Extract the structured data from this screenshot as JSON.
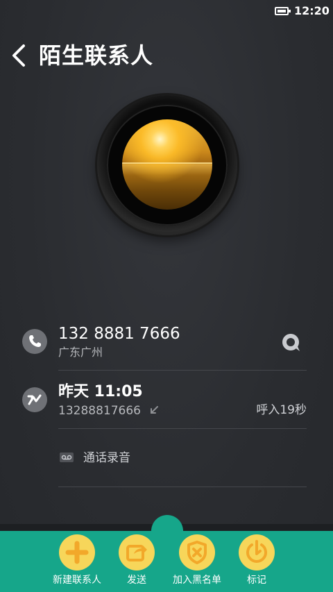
{
  "status_bar": {
    "time": "12:20",
    "battery_icon": "battery-icon"
  },
  "header": {
    "title": "陌生联系人",
    "back_icon": "chevron-left-icon"
  },
  "contact": {
    "phone_number": "132 8881 7666",
    "location": "广东广州"
  },
  "call_log": {
    "time": "昨天 11:05",
    "number": "13288817666",
    "direction_icon": "incoming-call-arrow-icon",
    "duration": "呼入19秒"
  },
  "recording": {
    "label": "通话录音"
  },
  "actions": [
    {
      "label": "新建联系人",
      "icon": "plus-icon"
    },
    {
      "label": "发送",
      "icon": "share-icon"
    },
    {
      "label": "加入黑名单",
      "icon": "block-shield-icon"
    },
    {
      "label": "标记",
      "icon": "mark-icon"
    }
  ],
  "colors": {
    "background": "#2b2d31",
    "bottom_bar": "#16a68a",
    "action_button": "#f7d65a",
    "action_glyph": "#f2b632"
  }
}
